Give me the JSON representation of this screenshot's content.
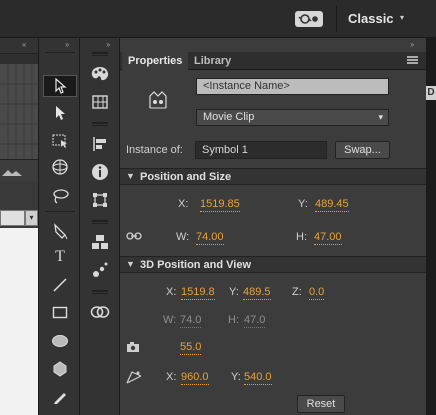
{
  "topbar": {
    "workspace_label": "Classic",
    "workspace_caret": "▾",
    "sync_icon": "sync-settings-icon"
  },
  "left_panel": {
    "collapse_arrows": "‹‹"
  },
  "tools": {
    "collapse_arrows": "››",
    "items": [
      {
        "name": "selection-tool",
        "icon": "arrow-icon",
        "selected": true
      },
      {
        "name": "subselection-tool",
        "icon": "subselect-arrow-icon"
      },
      {
        "name": "free-transform-tool",
        "icon": "free-transform-icon"
      },
      {
        "name": "3d-rotation-tool",
        "icon": "3d-rotation-icon"
      },
      {
        "name": "lasso-tool",
        "icon": "lasso-icon"
      },
      {
        "name": "pen-tool",
        "icon": "pen-icon"
      },
      {
        "name": "text-tool",
        "icon": "text-icon",
        "glyph": "T"
      },
      {
        "name": "line-tool",
        "icon": "line-icon"
      },
      {
        "name": "rectangle-tool",
        "icon": "rectangle-icon"
      },
      {
        "name": "oval-tool",
        "icon": "oval-icon"
      },
      {
        "name": "polystar-tool",
        "icon": "polystar-icon"
      },
      {
        "name": "pencil-tool",
        "icon": "pencil-icon"
      }
    ]
  },
  "dock": {
    "collapse_arrows": "››",
    "icons": [
      "color-palette-icon",
      "swatches-icon",
      "align-icon",
      "info-icon",
      "transform-icon",
      "components-icon",
      "motion-presets-icon",
      "cc-libraries-icon"
    ]
  },
  "properties": {
    "collapse_arrows": "››",
    "tabs": [
      {
        "label": "Properties"
      },
      {
        "label": "Library"
      }
    ],
    "instance_name_placeholder": "<Instance Name>",
    "symbol_type": "Movie Clip",
    "instance_of_label": "Instance of:",
    "symbol_name": "Symbol 1",
    "swap_label": "Swap...",
    "position_size": {
      "title": "Position and Size",
      "x_label": "X:",
      "x": "1519.85",
      "y_label": "Y:",
      "y": "489.45",
      "w_label": "W:",
      "w": "74.00",
      "h_label": "H:",
      "h": "47.00"
    },
    "position_3d": {
      "title": "3D Position and View",
      "x_label": "X:",
      "x": "1519.8",
      "y_label": "Y:",
      "y": "489.5",
      "z_label": "Z:",
      "z": "0.0",
      "w_label": "W:",
      "w": "74.0",
      "h_label": "H:",
      "h": "47.0",
      "perspective": "55.0",
      "vp_x_label": "X:",
      "vp_x": "960.0",
      "vp_y_label": "Y:",
      "vp_y": "540.0",
      "reset_label": "Reset"
    }
  },
  "right_edge": {
    "badge": "D"
  }
}
